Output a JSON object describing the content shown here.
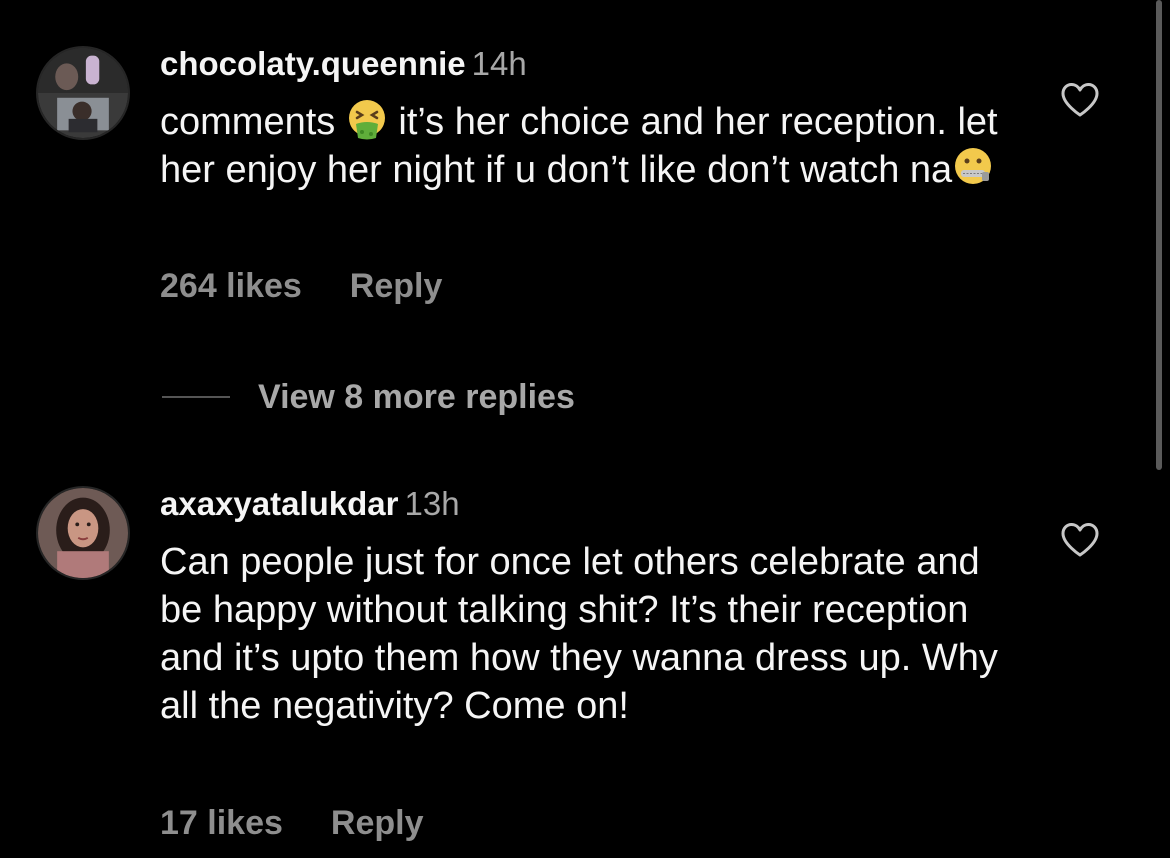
{
  "comments": [
    {
      "username": "chocolaty.queennie",
      "time": "14h",
      "text_part1": "comments",
      "emoji1": "nauseated-face",
      "text_part2": " it’s her choice and her reception. let her enjoy her night if u don’t like don’t watch na",
      "emoji2": "zipper-mouth-face",
      "likes": "264 likes",
      "reply_label": "Reply"
    },
    {
      "username": "axaxyatalukdar",
      "time": "13h",
      "text": "Can people just for once let others celebrate and be happy without talking shit? It’s their reception and it’s upto them how they wanna dress up. Why all the negativity? Come on!",
      "likes": "17 likes",
      "reply_label": "Reply"
    }
  ],
  "view_replies": {
    "label": "View 8 more replies"
  },
  "colors": {
    "background": "#000000",
    "primary_text": "#f5f5f5",
    "secondary_text": "#a8a8a8",
    "muted_text": "#8e8e8e"
  },
  "icons": {
    "like": "heart-outline-icon"
  }
}
